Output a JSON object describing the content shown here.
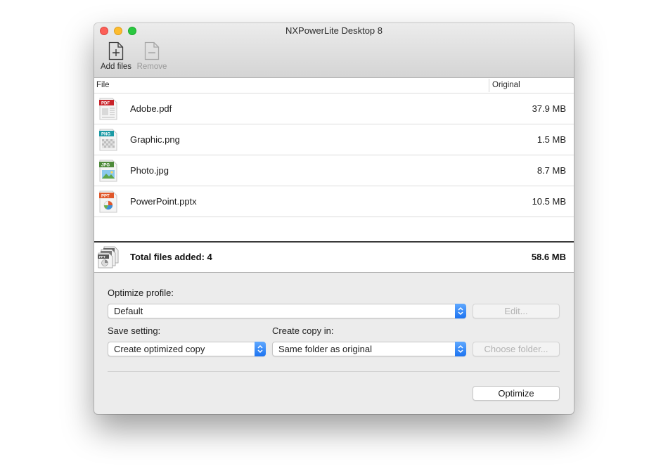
{
  "window": {
    "title": "NXPowerLite Desktop 8"
  },
  "toolbar": {
    "add_label": "Add files",
    "remove_label": "Remove"
  },
  "table": {
    "columns": {
      "file": "File",
      "original": "Original"
    },
    "rows": [
      {
        "name": "Adobe.pdf",
        "size": "37.9 MB",
        "type": "PDF",
        "color": "#c9232a"
      },
      {
        "name": "Graphic.png",
        "size": "1.5 MB",
        "type": "PNG",
        "color": "#1b9aa5"
      },
      {
        "name": "Photo.jpg",
        "size": "8.7 MB",
        "type": "JPG",
        "color": "#4e8a3a"
      },
      {
        "name": "PowerPoint.pptx",
        "size": "10.5 MB",
        "type": "PPT",
        "color": "#e0572a"
      }
    ],
    "total_label": "Total files added: 4",
    "total_size": "58.6 MB"
  },
  "settings": {
    "optimize_profile_label": "Optimize profile:",
    "profile_value": "Default",
    "edit_label": "Edit...",
    "save_setting_label": "Save setting:",
    "save_setting_value": "Create optimized copy",
    "create_copy_label": "Create copy in:",
    "create_copy_value": "Same folder as original",
    "choose_folder_label": "Choose folder...",
    "optimize_label": "Optimize"
  },
  "colors": {
    "accent": "#1c73f0"
  },
  "icons": {
    "add": "add-file-icon",
    "remove": "remove-file-icon",
    "summary": "files-stack-icon"
  }
}
